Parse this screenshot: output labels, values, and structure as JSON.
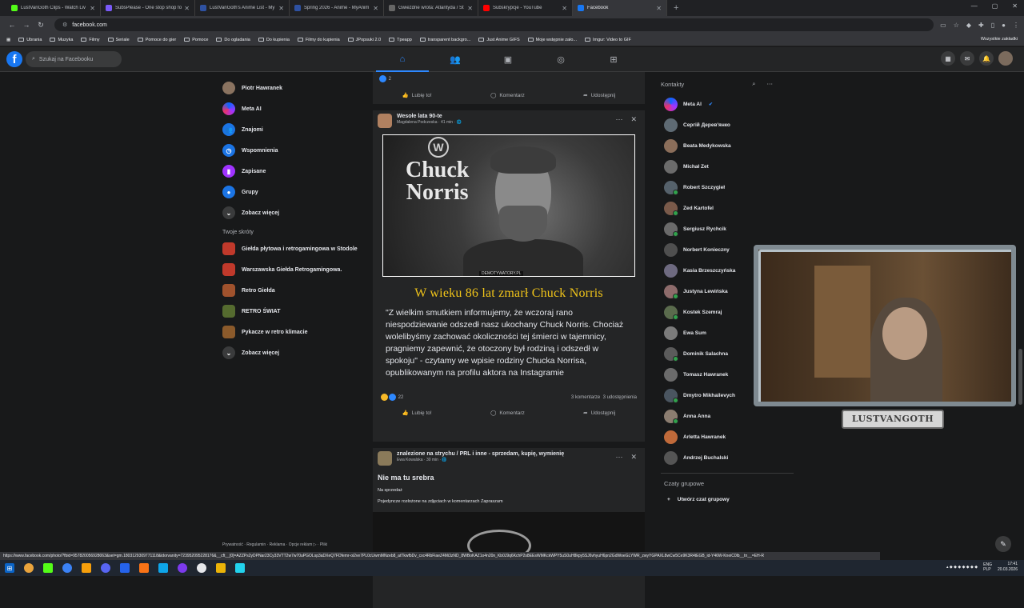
{
  "browser": {
    "tabs": [
      {
        "label": "LustVanGoth Clips - Watch Liv",
        "color": "#53fc18",
        "active": false
      },
      {
        "label": "SubsPlease - One stop shop fo",
        "color": "#7a5af8",
        "active": false
      },
      {
        "label": "LustVanGoth's Anime List - My",
        "color": "#2e51a2",
        "active": false
      },
      {
        "label": "Spring 2026 - Anime - MyAnim",
        "color": "#2e51a2",
        "active": false
      },
      {
        "label": "Gwiezdne wrota: Atlantyda / St",
        "color": "#666666",
        "active": false
      },
      {
        "label": "Subskrypcje - YouTube",
        "color": "#ff0000",
        "active": false
      },
      {
        "label": "Facebook",
        "color": "#1877f2",
        "active": true
      }
    ],
    "new_tab": "+",
    "url": "facebook.com",
    "bookmarks": [
      "Ubrania",
      "Muzyka",
      "Filmy",
      "Seriale",
      "Pomoce do gier",
      "Pomoce",
      "Do ogladania",
      "Do kupienia",
      "Filmy do kupienia",
      "JPopsuki 2.0",
      "Tpeapp",
      "transparent backgro...",
      "Just Anime GIFS",
      "Moje wstępnie zało...",
      "Imgur: Video to GIF"
    ],
    "bookmarks_right": "Wszystkie zakładki",
    "status_url": "https://www.facebook.com/photo/?fbid=957820056928063&set=gm.1803129309771118&idorvanity=723952095228176&__cft__[0]=AZZPs2yDPNar23Cy33VTT2w7w70uPGOLsp3aDXeQ7FDfemr-oi2ve7PL0cUwmMNzeb8_atTkwfbDv_cxc4RbFiaeZ4Mi3zND_8WBoKAZ1o4n20n_Kb0J9q6KchP2s8EEsWMKckWPY5uS0uH8kpy5SJ6vhyuH6pn2GdWoeGLYWR_zwyYGPAXL8wCw5Ce9K3R4tEGB_id-Y46W-KneiC0lb__tn__=EH-R"
  },
  "fb": {
    "search_placeholder": "Szukaj na Facebooku",
    "logo": "f"
  },
  "left": {
    "items": [
      {
        "label": "Piotr Hawranek",
        "icon": "avatar"
      },
      {
        "label": "Meta AI",
        "icon": "meta-ai-icon"
      },
      {
        "label": "Znajomi",
        "icon": "friends-icon"
      },
      {
        "label": "Wspomnienia",
        "icon": "memories-icon"
      },
      {
        "label": "Zapisane",
        "icon": "saved-icon"
      },
      {
        "label": "Grupy",
        "icon": "groups-icon"
      },
      {
        "label": "Zobacz więcej",
        "icon": "chevron-down-icon"
      }
    ],
    "shortcuts_title": "Twoje skróty",
    "shortcuts": [
      "Giełda płytowa i retrogamingowa w Stodole",
      "Warszawska Giełda Retrogamingowa.",
      "Retro Giełda",
      "RETRO ŚWIAT",
      "Pykacze w retro klimacie",
      "Zobacz więcej"
    ],
    "footer": "Prywatność · Regulamin · Reklama · Opcje reklam ▷ · Pliki"
  },
  "feed": {
    "prev_post": {
      "reaction_count": "2",
      "like": "Lubię to!",
      "comment": "Komentarz",
      "share": "Udostępnij"
    },
    "post1": {
      "group": "Wesołe lata 90-te",
      "meta": "Magdalena Podczeska · 41 min · 🌐",
      "image_text_1": "Chuck",
      "image_text_2": "Norris",
      "image_logo": "W",
      "watermark": "DEMOTYWATORY.PL",
      "title": "W wieku 86 lat zmarł Chuck Norris",
      "body": "\"Z wielkim smutkiem informujemy, że wczoraj rano niespodziewanie odszedł nasz ukochany Chuck Norris. Chociaż wolelibyśmy zachować okoliczności tej śmierci w tajemnicy, pragniemy zapewnić, że otoczony był rodziną i odszedł w spokoju\" - czytamy we wpisie rodziny Chucka Norrisa, opublikowanym na profilu aktora na Instagramie",
      "reaction_count": "22",
      "comments": "3 komentarze",
      "shares": "3 udostępnienia",
      "like": "Lubię to!",
      "comment": "Komentarz",
      "share": "Udostępnij"
    },
    "post2": {
      "group": "znalezione na strychu / PRL i inne - sprzedam, kupię, wymienię",
      "meta": "Ewa Kowalska · 30 min · 🌐",
      "title": "Nie ma tu srebra",
      "sub": "Na sprzedaż",
      "desc": "Pojedyncze rozłożone na zdjęciach w komentarzach Zapraszam"
    }
  },
  "right": {
    "title": "Kontakty",
    "contacts": [
      {
        "name": "Meta AI",
        "verified": true,
        "online": false,
        "color": "#6a4cff"
      },
      {
        "name": "Сергій Дерев'янко",
        "online": false,
        "color": "#5e6a73"
      },
      {
        "name": "Beata Medykowska",
        "online": false,
        "color": "#8b6e5a"
      },
      {
        "name": "Michał Zet",
        "online": false,
        "color": "#6b6b6b"
      },
      {
        "name": "Robert Szczygieł",
        "online": true,
        "color": "#55616b"
      },
      {
        "name": "Zed Kartofel",
        "online": true,
        "color": "#7a5a4a"
      },
      {
        "name": "Sergiusz Rychcik",
        "online": true,
        "color": "#6a6a6a"
      },
      {
        "name": "Norbert Konieczny",
        "online": false,
        "color": "#4f4f4f"
      },
      {
        "name": "Kasia Brzeszczyńska",
        "online": false,
        "color": "#6e6a80"
      },
      {
        "name": "Justyna Lewińska",
        "online": true,
        "color": "#8d6b6b"
      },
      {
        "name": "Kostek Szemraj",
        "online": true,
        "color": "#5a6b4d"
      },
      {
        "name": "Ewa Sum",
        "online": false,
        "color": "#7b7b7b"
      },
      {
        "name": "Dominik Salachna",
        "online": true,
        "color": "#5b5b5b"
      },
      {
        "name": "Tomasz Hawranek",
        "online": false,
        "color": "#6b6b6b"
      },
      {
        "name": "Dmytro Mikhailevych",
        "online": true,
        "color": "#4a5560"
      },
      {
        "name": "Anna Anna",
        "online": true,
        "color": "#8b7d70"
      },
      {
        "name": "Arletta Hawranek",
        "online": false,
        "color": "#c06a3a"
      },
      {
        "name": "Andrzej Buchalski",
        "online": false,
        "color": "#555555"
      }
    ],
    "group_chats": "Czaty grupowe",
    "create_group": "Utwórz czat grupowy"
  },
  "overlay": {
    "label": "LUSTVANGOTH"
  },
  "taskbar": {
    "lang": "ENG",
    "lang2": "PLP",
    "time": "17:41",
    "date": "20.03.2026"
  }
}
